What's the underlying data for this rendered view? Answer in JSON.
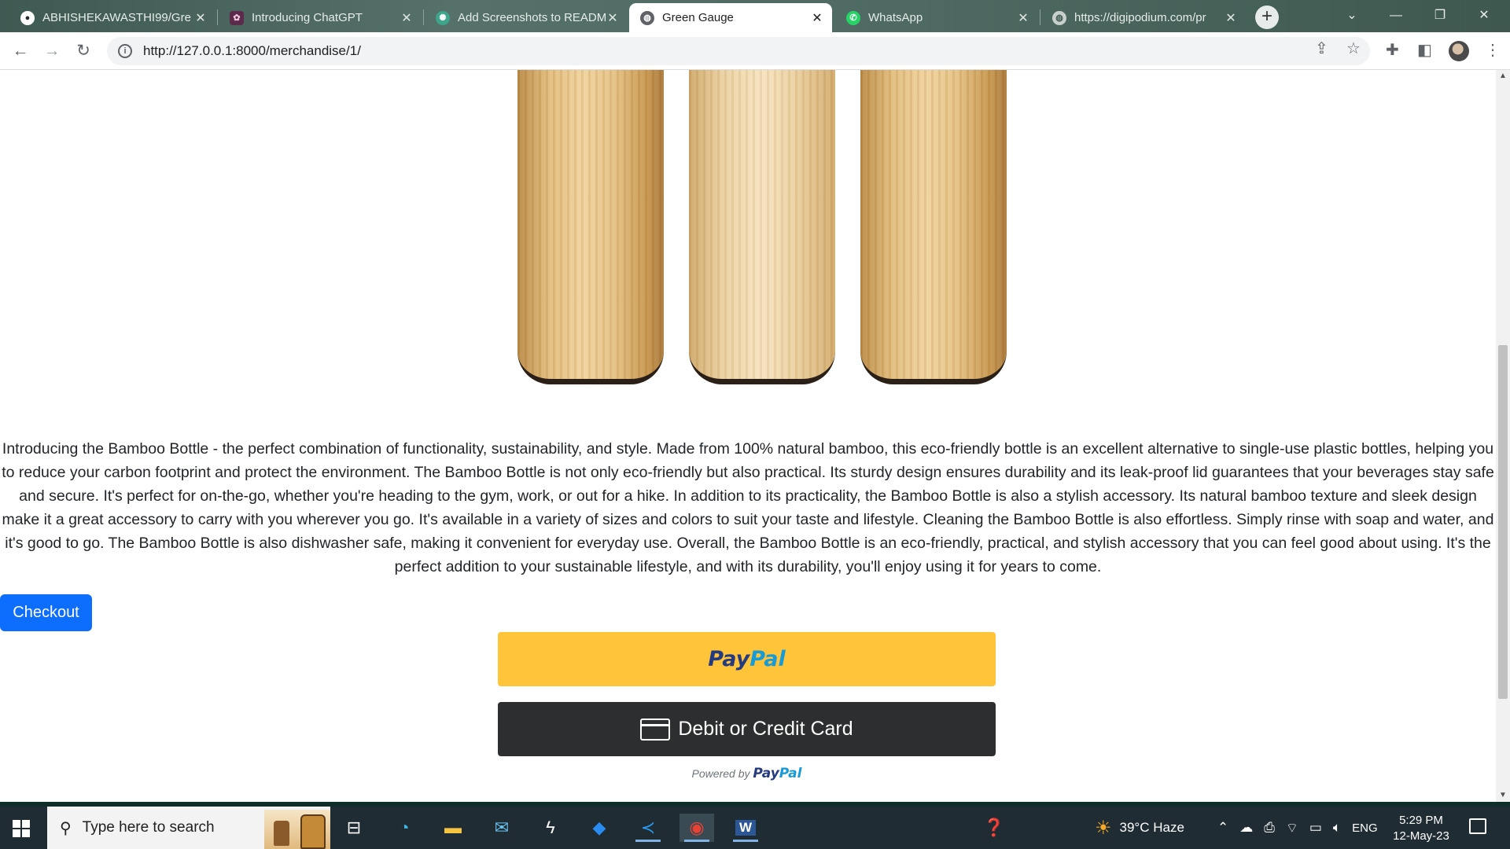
{
  "browser": {
    "tabs": [
      {
        "title": "ABHISHEKAWASTHI99/Gre",
        "icon": "github-icon",
        "active": false
      },
      {
        "title": "Introducing ChatGPT",
        "icon": "chatgpt-icon",
        "active": false
      },
      {
        "title": "Add Screenshots to READM",
        "icon": "openai-icon",
        "active": false
      },
      {
        "title": "Green Gauge",
        "icon": "globe-icon",
        "active": true
      },
      {
        "title": "WhatsApp",
        "icon": "whatsapp-icon",
        "active": false
      },
      {
        "title": "https://digipodium.com/pr",
        "icon": "globe-icon",
        "active": false
      }
    ],
    "new_tab_symbol": "+",
    "window_controls": {
      "dropdown": "⌄",
      "minimize": "—",
      "restore": "❐",
      "close": "✕"
    },
    "nav": {
      "back": "←",
      "forward": "→",
      "reload": "↻"
    },
    "url": "http://127.0.0.1:8000/merchandise/1/",
    "url_icon": "i"
  },
  "product": {
    "image_alt": "bamboo-bottles",
    "description": "Introducing the Bamboo Bottle - the perfect combination of functionality, sustainability, and style. Made from 100% natural bamboo, this eco-friendly bottle is an excellent alternative to single-use plastic bottles, helping you to reduce your carbon footprint and protect the environment. The Bamboo Bottle is not only eco-friendly but also practical. Its sturdy design ensures durability and its leak-proof lid guarantees that your beverages stay safe and secure. It's perfect for on-the-go, whether you're heading to the gym, work, or out for a hike. In addition to its practicality, the Bamboo Bottle is also a stylish accessory. Its natural bamboo texture and sleek design make it a great accessory to carry with you wherever you go. It's available in a variety of sizes and colors to suit your taste and lifestyle. Cleaning the Bamboo Bottle is also effortless. Simply rinse with soap and water, and it's good to go. The Bamboo Bottle is also dishwasher safe, making it convenient for everyday use. Overall, the Bamboo Bottle is an eco-friendly, practical, and stylish accessory that you can feel good about using. It's the perfect addition to your sustainable lifestyle, and with its durability, you'll enjoy using it for years to come.",
    "checkout_label": "Checkout"
  },
  "payment": {
    "paypal_part1": "Pay",
    "paypal_part2": "Pal",
    "card_label": "Debit or Credit Card",
    "powered_by": "Powered by",
    "powered_brand_1": "Pay",
    "powered_brand_2": "Pal",
    "colors": {
      "paypal_yellow": "#ffc439",
      "card_dark": "#2c2e2f",
      "checkout_blue": "#0d6efd"
    }
  },
  "taskbar": {
    "search_placeholder": "Type here to search",
    "weather": "39°C  Haze",
    "language": "ENG",
    "time": "5:29 PM",
    "date": "12-May-23"
  }
}
